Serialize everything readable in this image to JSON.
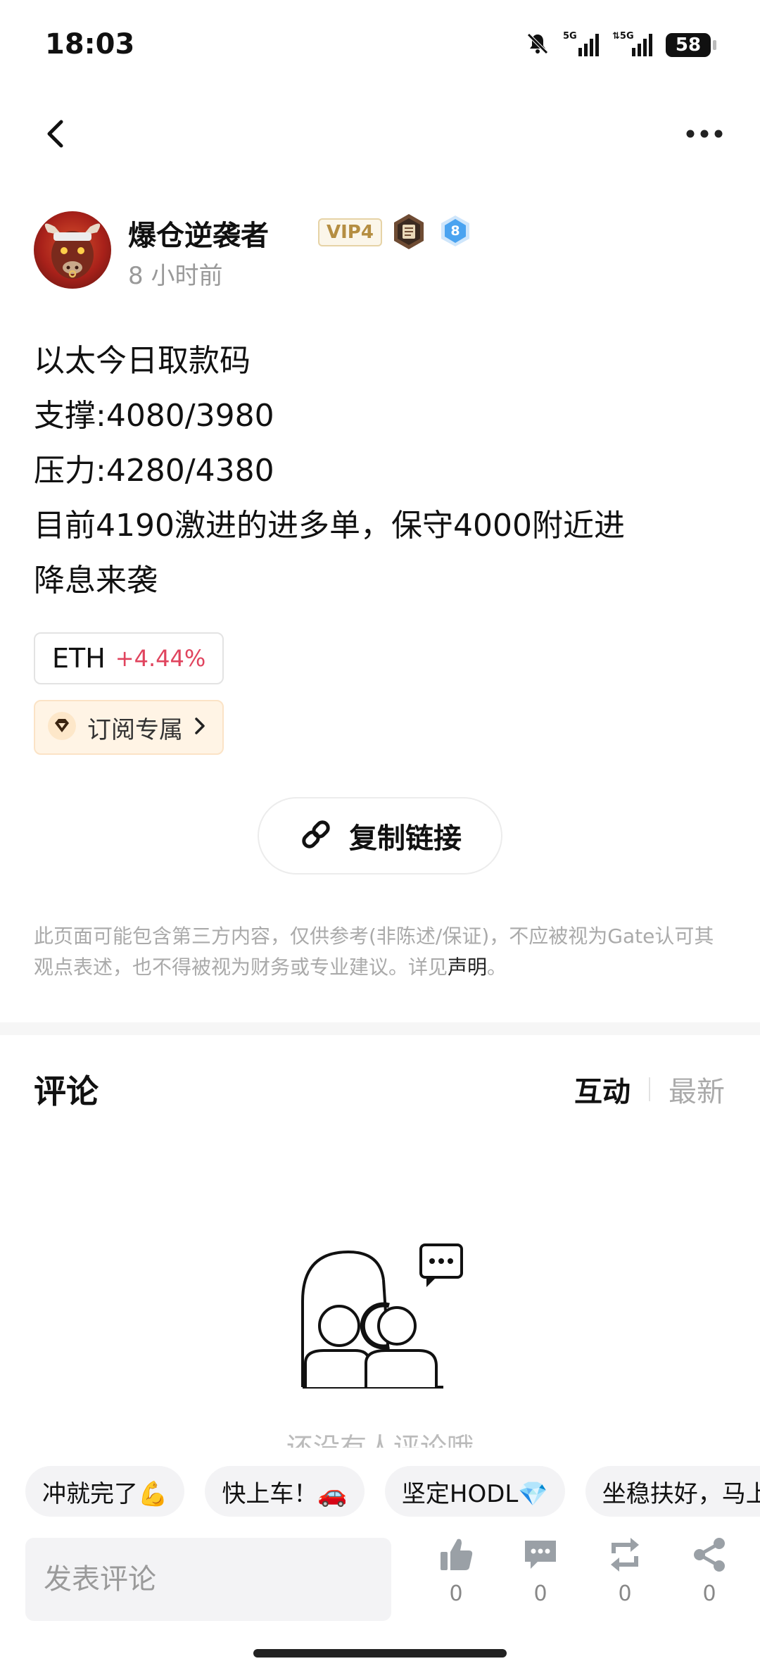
{
  "status_bar": {
    "time": "18:03",
    "battery": "58",
    "icons": [
      "bell-off-icon",
      "signal-5g-icon",
      "signal-5g-icon",
      "battery-icon"
    ]
  },
  "nav": {
    "back_icon": "chevron-left-icon",
    "more_icon": "more-horizontal-icon"
  },
  "author": {
    "name": "爆仓逆袭者",
    "vip": "VIP4",
    "level": "8",
    "time": "8 小时前"
  },
  "post": {
    "lines": [
      "以太今日取款码",
      "支撑:4080/3980",
      "压力:4280/4380",
      "目前4190激进的进多单，保守4000附近进",
      "降息来袭"
    ]
  },
  "token": {
    "name": "ETH",
    "change": "+4.44%"
  },
  "subscription": {
    "label": "订阅专属"
  },
  "copy_link": {
    "label": "复制链接"
  },
  "disclaimer": {
    "text": "此页面可能包含第三方内容，仅供参考(非陈述/保证)，不应被视为Gate认可其观点表述，也不得被视为财务或专业建议。详见",
    "link": "声明",
    "end": "。"
  },
  "comments": {
    "title": "评论",
    "tabs": [
      "互动",
      "最新"
    ],
    "empty_text": "还没有人评论哦"
  },
  "quick_replies": [
    "冲就完了💪",
    "快上车！🚗",
    "坚定HODL💎",
    "坐稳扶好，马上起飞"
  ],
  "bottom_bar": {
    "input_placeholder": "发表评论",
    "like_count": "0",
    "comment_count": "0",
    "repost_count": "0",
    "share_count": "0"
  },
  "colors": {
    "token_change": "#e0445e",
    "vip_gold": "#b58e42",
    "level_blue": "#4aa3f0"
  }
}
